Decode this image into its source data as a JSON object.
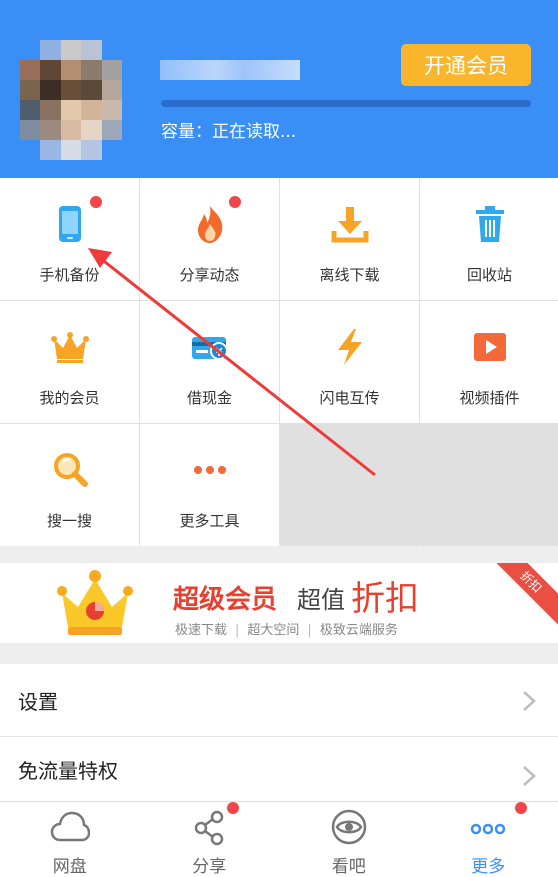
{
  "header": {
    "vip_button": "开通会员",
    "capacity_text": "容量：正在读取..."
  },
  "tools": [
    {
      "label": "手机备份",
      "icon": "phone-backup-icon",
      "badge": true
    },
    {
      "label": "分享动态",
      "icon": "flame-icon",
      "badge": true
    },
    {
      "label": "离线下载",
      "icon": "download-icon",
      "badge": false
    },
    {
      "label": "回收站",
      "icon": "trash-icon",
      "badge": false
    },
    {
      "label": "我的会员",
      "icon": "crown-icon",
      "badge": false
    },
    {
      "label": "借现金",
      "icon": "cash-icon",
      "badge": false
    },
    {
      "label": "闪电互传",
      "icon": "lightning-icon",
      "badge": false
    },
    {
      "label": "视频插件",
      "icon": "video-plugin-icon",
      "badge": false
    },
    {
      "label": "搜一搜",
      "icon": "search-icon",
      "badge": false
    },
    {
      "label": "更多工具",
      "icon": "more-tools-icon",
      "badge": false
    }
  ],
  "banner": {
    "title_bold": "超级会员",
    "title_mid": "超值",
    "title_big": "折扣",
    "features": [
      "极速下载",
      "超大空间",
      "极致云端服务"
    ],
    "ribbon": "折扣"
  },
  "menu": [
    {
      "label": "设置"
    },
    {
      "label": "免流量特权"
    }
  ],
  "tabs": [
    {
      "label": "网盘",
      "icon": "cloud-icon",
      "badge": false,
      "active": false
    },
    {
      "label": "分享",
      "icon": "share-icon",
      "badge": true,
      "active": false
    },
    {
      "label": "看吧",
      "icon": "eye-icon",
      "badge": false,
      "active": false
    },
    {
      "label": "更多",
      "icon": "more-dots-icon",
      "badge": true,
      "active": true
    }
  ],
  "colors": {
    "header_blue": "#3a8ff7",
    "vip_orange": "#f9b52b",
    "badge_red": "#f0464a",
    "accent_red": "#e8402f"
  }
}
